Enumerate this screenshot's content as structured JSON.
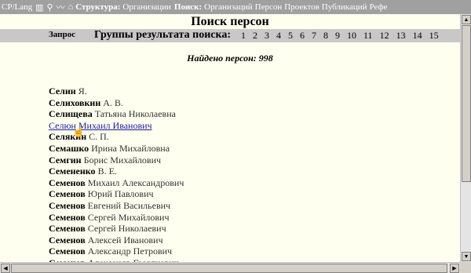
{
  "toolbar": {
    "lang": "CP/Lang",
    "icons": [
      "book-icon",
      "pin-icon",
      "map-icon",
      "structure-icon"
    ],
    "structure_label": "Структура:",
    "structure_link": "Организации",
    "search_label": "Поиск:",
    "search_links": [
      "Организаций",
      "Персон",
      "Проектов",
      "Публикаций",
      "Рефе"
    ]
  },
  "title": "Поиск персон",
  "groups": {
    "query": "Запрос",
    "label": "Группы результата поиска:",
    "pages": [
      "1",
      "2",
      "3",
      "4",
      "5",
      "6",
      "7",
      "8",
      "9",
      "10",
      "11",
      "12",
      "13",
      "14",
      "15"
    ]
  },
  "found": "Найдено персон: 998",
  "persons": [
    {
      "surname": "Селин",
      "name": "Я."
    },
    {
      "surname": "Селиховкин",
      "name": "А. В."
    },
    {
      "surname": "Селищева",
      "name": "Татьяна Николаевна"
    },
    {
      "surname": "Селюн",
      "name": "Михаил Иванович",
      "selected": true
    },
    {
      "surname": "Селякин",
      "name": "С. П."
    },
    {
      "surname": "Семашко",
      "name": "Ирина Михайловна"
    },
    {
      "surname": "Семгин",
      "name": "Борис Михайлович"
    },
    {
      "surname": "Семененко",
      "name": "В. Е."
    },
    {
      "surname": "Семенов",
      "name": "Михаил Александрович"
    },
    {
      "surname": "Семенов",
      "name": "Юрий Павлович"
    },
    {
      "surname": "Семенов",
      "name": "Евгений Васильевич"
    },
    {
      "surname": "Семенов",
      "name": "Сергей Михайлович"
    },
    {
      "surname": "Семенов",
      "name": "Сергей Николаевич"
    },
    {
      "surname": "Семенов",
      "name": "Алексей Иванович"
    },
    {
      "surname": "Семенов",
      "name": "Александр Петрович"
    },
    {
      "surname": "Семенов",
      "name": "Александр Георгиевич"
    }
  ]
}
